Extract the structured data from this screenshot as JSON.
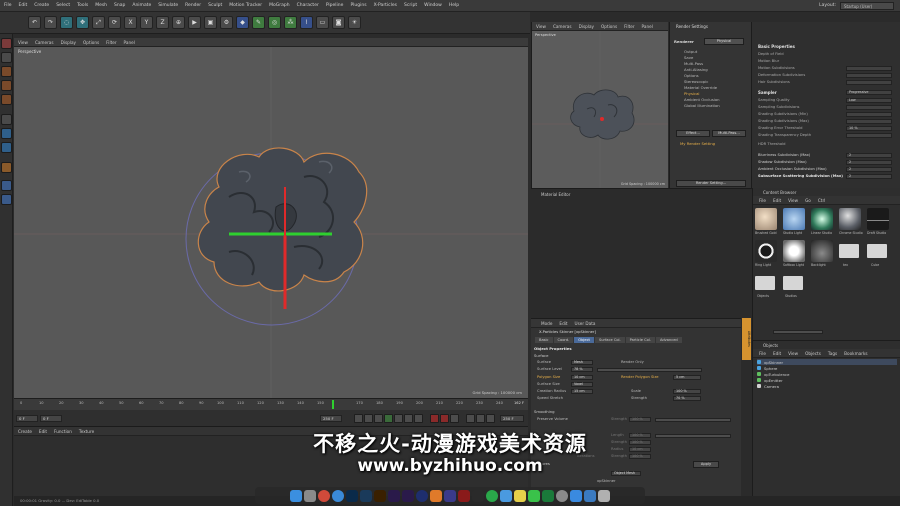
{
  "menubar": {
    "items": [
      "File",
      "Edit",
      "Create",
      "Select",
      "Tools",
      "Mesh",
      "Snap",
      "Animate",
      "Simulate",
      "Render",
      "Sculpt",
      "Motion Tracker",
      "MoGraph",
      "Character",
      "Pipeline",
      "Plugins",
      "X-Particles",
      "Script",
      "Window",
      "Help"
    ],
    "layout_label": "Layout:",
    "layout_value": "Startup (User)"
  },
  "toolbar": {
    "buttons": [
      "undo-icon",
      "redo-icon",
      "live-select-icon",
      "move-icon",
      "scale-icon",
      "rotate-icon",
      "x-axis-icon",
      "y-axis-icon",
      "z-axis-icon",
      "coordinate-icon",
      "render-view-icon",
      "render-picture-icon",
      "render-settings-icon",
      "cube-icon",
      "spline-pen-icon",
      "nurbs-icon",
      "array-icon",
      "deformer-icon",
      "floor-icon",
      "camera-icon",
      "light-icon"
    ],
    "xyz": [
      "X",
      "Y",
      "Z"
    ]
  },
  "viewport": {
    "menu": [
      "View",
      "Cameras",
      "Display",
      "Options",
      "Filter",
      "Panel"
    ],
    "label": "Perspective",
    "grid_info": "Grid Spacing : 100000 cm"
  },
  "timeline": {
    "ticks": [
      "0",
      "10",
      "20",
      "30",
      "40",
      "50",
      "60",
      "70",
      "80",
      "90",
      "100",
      "110",
      "120",
      "130",
      "140",
      "150",
      "160",
      "170",
      "180",
      "190",
      "200",
      "210",
      "220",
      "230",
      "240"
    ],
    "current_frame": "162 F",
    "start_field": "0 F",
    "end_field": "250 F",
    "left_field": "0 F",
    "right_field": "250 F"
  },
  "material_manager": {
    "menu": [
      "Create",
      "Edit",
      "Function",
      "Texture"
    ]
  },
  "status": {
    "text": "00:00:01  Gravity: 0.0 ... Dev: EdiTable 0.0"
  },
  "view2": {
    "menu": [
      "View",
      "Cameras",
      "Display",
      "Options",
      "Filter",
      "Panel"
    ],
    "label": "Perspective",
    "grid_info": "Grid Spacing : 100000 cm"
  },
  "render_settings": {
    "title": "Render Settings",
    "renderer_label": "Renderer",
    "renderer_value": "Physical",
    "items": [
      "Output",
      "Save",
      "Multi-Pass",
      "Anti-Aliasing",
      "Options",
      "Stereoscopic",
      "Material Override",
      "Physical",
      "Ambient Occlusion",
      "Global Illumination"
    ],
    "effect_button": "Effect...",
    "multipass_button": "Multi-Pass...",
    "my_setting": "My Render Setting",
    "render_setting_button": "Render Setting..."
  },
  "render_props": {
    "basic_head": "Basic Properties",
    "rows": [
      {
        "label": "Depth of Field",
        "value": ""
      },
      {
        "label": "Motion Blur",
        "value": ""
      },
      {
        "label": "Motion Subdivisions",
        "value": ""
      },
      {
        "label": "Deformation Subdivisions",
        "value": ""
      },
      {
        "label": "Hair Subdivisions",
        "value": ""
      }
    ],
    "sampler_label": "Sampler",
    "sampler_value": "Progressive",
    "rows2": [
      {
        "label": "Sampling Quality",
        "value": "Low"
      },
      {
        "label": "Sampling Subdivisions",
        "value": ""
      },
      {
        "label": "Shading Subdivisions (Min)",
        "value": ""
      },
      {
        "label": "Shading Subdivisions (Max)",
        "value": ""
      },
      {
        "label": "Shading Error Threshold",
        "value": "10 %"
      },
      {
        "label": "Shading Transparency Depth",
        "value": ""
      },
      {
        "label": "HDR Threshold",
        "value": ""
      },
      {
        "label": "Blurriness Subdivision (Max)",
        "value": "2"
      },
      {
        "label": "Shadow Subdivision (Max)",
        "value": "2"
      },
      {
        "label": "Ambient Occlusion Subdivision (Max)",
        "value": "2"
      },
      {
        "label": "Subsurface Scattering Subdivision (Max)",
        "value": "2"
      }
    ]
  },
  "material_editor": {
    "title": "Material Editor"
  },
  "attributes": {
    "menu": [
      "Mode",
      "Edit",
      "User Data"
    ],
    "object_title": "X-Particles Skinner [xpSkinner]",
    "tabs": [
      "Basic",
      "Coord.",
      "Object",
      "Surface Col.",
      "Particle Col.",
      "Advanced"
    ],
    "active_tab": "Object",
    "section_title": "Object Properties",
    "surface_section": "Surface",
    "rows": [
      {
        "label": "Surface",
        "value": "Mesh"
      },
      {
        "label": "Surface Level",
        "value": "78 %"
      },
      {
        "label": "Polygon Size",
        "value": "10 cm"
      },
      {
        "label": "Surface Size",
        "value": "Voxel"
      },
      {
        "label": "Creation Radius",
        "value": "15 cm"
      },
      {
        "label": "Speed Stretch",
        "value": ""
      }
    ],
    "right_rows": [
      {
        "label": "Render Only",
        "value": ""
      },
      {
        "label": "Render Polygon Size",
        "value": "5 cm"
      },
      {
        "label": "Scale",
        "value": "100 %"
      },
      {
        "label": "Strength",
        "value": "70 %"
      }
    ],
    "smoothing_section": "Smoothing",
    "smoothing_rows": [
      {
        "label": "Preserve Volume",
        "value": ""
      },
      {
        "label": "Strength",
        "value": "100 %"
      },
      {
        "label": "Length",
        "value": "100 %"
      },
      {
        "label": "Strength",
        "value": "100 %"
      },
      {
        "label": "Radius",
        "value": "10 cm"
      },
      {
        "label": "Strength",
        "value": "100 %"
      }
    ],
    "iterations_label": "Iterations",
    "apply_button": "Apply",
    "textures_section": "Textures",
    "object_field": "Object Mesh",
    "skinner_label": "xpSkinner"
  },
  "content_browser": {
    "title": "Content Browser",
    "menu": [
      "File",
      "Edit",
      "View",
      "Go",
      "Ctrl"
    ],
    "thumbs": [
      {
        "label": "Brushed Gold",
        "color": "#e8d2b8"
      },
      {
        "label": "Studio Light",
        "color": "#6d9ed2"
      },
      {
        "label": "Linear Studio",
        "color": "#7fe0b5"
      },
      {
        "label": "Chrome Studio",
        "color": "#9a9ea6"
      },
      {
        "label": "Draft Studio",
        "color": "#1a1a1a"
      },
      {
        "label": "Ring Light",
        "color": "#f0f0f0"
      },
      {
        "label": "Softbox Light",
        "color": "#f5f5f5"
      },
      {
        "label": "Backlight",
        "color": "#3a3a3a"
      },
      {
        "label": "tex",
        "color": "#d6d6d6"
      },
      {
        "label": "Cube",
        "color": "#d6d6d6"
      }
    ],
    "folders": [
      "Objects",
      "Studios"
    ]
  },
  "object_manager": {
    "title": "Objects",
    "menu": [
      "File",
      "Edit",
      "View",
      "Objects",
      "Tags",
      "Bookmarks"
    ],
    "rows": [
      {
        "name": "xpSkinner",
        "color": "#4aa3e0"
      },
      {
        "name": "Sphere",
        "color": "#4aa3e0"
      },
      {
        "name": "xpTurbulence",
        "color": "#5fbf5f"
      },
      {
        "name": "xpEmitter",
        "color": "#5fbf5f"
      },
      {
        "name": "Camera",
        "color": "#d0d0d0"
      }
    ]
  },
  "dock": {
    "icons": [
      {
        "name": "finder-icon",
        "color": "#3b8fe0"
      },
      {
        "name": "launchpad-icon",
        "color": "#8a8a8a"
      },
      {
        "name": "chrome-icon",
        "color": "#d04a3a"
      },
      {
        "name": "safari-icon",
        "color": "#3a8ad8"
      },
      {
        "name": "photoshop-icon",
        "color": "#0a2a4a"
      },
      {
        "name": "lightroom-icon",
        "color": "#1a3a5a"
      },
      {
        "name": "illustrator-icon",
        "color": "#3a2000"
      },
      {
        "name": "after-effects-icon",
        "color": "#2a1a4a"
      },
      {
        "name": "premiere-icon",
        "color": "#2a1a4a"
      },
      {
        "name": "cinema4d-icon",
        "color": "#1e2e6e"
      },
      {
        "name": "blender-icon",
        "color": "#e07a2a"
      },
      {
        "name": "lua-icon",
        "color": "#3a3a8a"
      },
      {
        "name": "redshift-icon",
        "color": "#8a1a1a"
      },
      {
        "name": "unity-icon",
        "color": "#2a2a2a"
      },
      {
        "name": "spotify-icon",
        "color": "#2aa84a"
      },
      {
        "name": "finder2-icon",
        "color": "#4a9ae0"
      },
      {
        "name": "notes-icon",
        "color": "#e6d04a"
      },
      {
        "name": "messages-icon",
        "color": "#3ac24a"
      },
      {
        "name": "excel-icon",
        "color": "#1a7a3a"
      },
      {
        "name": "settings-icon",
        "color": "#8a8a8a"
      },
      {
        "name": "app-store-icon",
        "color": "#3a8ae0"
      },
      {
        "name": "downloads-icon",
        "color": "#3a7ac0"
      },
      {
        "name": "trash-icon",
        "color": "#b0b0b0"
      }
    ]
  },
  "watermark": {
    "cn": "不移之火-动漫游戏美术资源",
    "url": "www.byzhihuo.com"
  },
  "colors": {
    "axis_green": "#2fd02f",
    "axis_red": "#e02a2a",
    "selection_orange": "#d6932f",
    "active_tab": "#4a6a9a"
  },
  "side_tab": "Attributes"
}
